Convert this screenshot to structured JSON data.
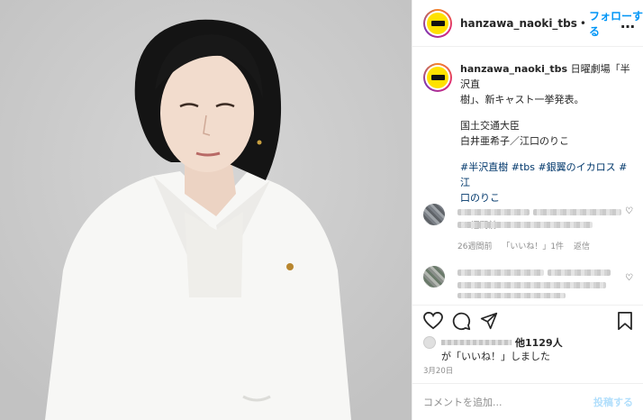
{
  "header": {
    "username": "hanzawa_naoki_tbs",
    "separator": "•",
    "follow_label": "フォローする",
    "more_icon": "…"
  },
  "caption": {
    "username": "hanzawa_naoki_tbs",
    "line1": "日曜劇場「半沢直",
    "line2": "樹」、新キャスト一挙発表。",
    "line3": "国土交通大臣",
    "line4": "白井亜希子／江口のりこ",
    "tags_line1": "#半沢直樹 #tbs #銀翼のイカロス #江",
    "tags_line2": "口のりこ",
    "time": "26週間前"
  },
  "comments": [
    {
      "meta_time": "26週間前",
      "meta_likes": "「いいね！」1件",
      "meta_reply": "返信"
    },
    {}
  ],
  "actions": {
    "like_icon": "heart-icon",
    "comment_icon": "comment-icon",
    "share_icon": "share-icon",
    "save_icon": "bookmark-icon"
  },
  "likes": {
    "count": "他1129人",
    "text": "が「いいね！」しました"
  },
  "post_date": "3月20日",
  "add_comment": {
    "placeholder": "コメントを追加...",
    "post_label": "投稿する"
  }
}
